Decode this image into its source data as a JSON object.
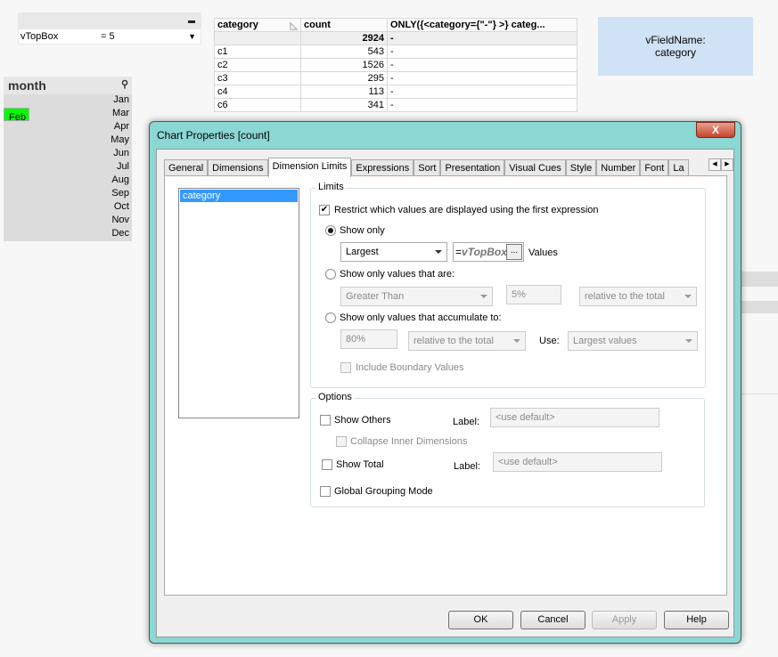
{
  "input_box": {
    "variable": "vTopBox",
    "value": "= 5"
  },
  "table": {
    "headers": [
      "category",
      "count",
      "ONLY({<category={\"-\"} >} categ..."
    ],
    "total": {
      "count": "2924",
      "only": "-"
    },
    "rows": [
      [
        "c1",
        "543",
        "-"
      ],
      [
        "c2",
        "1526",
        "-"
      ],
      [
        "c3",
        "295",
        "-"
      ],
      [
        "c4",
        "113",
        "-"
      ],
      [
        "c6",
        "341",
        "-"
      ]
    ]
  },
  "text_object": {
    "line1": "vFieldName:",
    "line2": "category"
  },
  "listbox": {
    "title": "month",
    "items": [
      "Jan",
      "Feb",
      "Mar",
      "Apr",
      "May",
      "Jun",
      "Jul",
      "Aug",
      "Sep",
      "Oct",
      "Nov",
      "Dec"
    ],
    "selected": "Feb"
  },
  "dialog": {
    "title": "Chart Properties [count]",
    "close": "X",
    "tabs": [
      "General",
      "Dimensions",
      "Dimension Limits",
      "Expressions",
      "Sort",
      "Presentation",
      "Visual Cues",
      "Style",
      "Number",
      "Font",
      "La"
    ],
    "active_tab": "Dimension Limits",
    "dimensions": [
      "category"
    ],
    "limits": {
      "legend": "Limits",
      "restrict_label": "Restrict which values are displayed using the first expression",
      "restrict_checked": true,
      "show_only_label": "Show only",
      "show_only_selected": true,
      "show_only_mode": "Largest",
      "show_only_expr": "=vTopBox",
      "expr_btn": "...",
      "values_label": "Values",
      "values_are_label": "Show only values that are:",
      "compare": "Greater Than",
      "compare_value": "5%",
      "relative1": "relative to the total",
      "accumulate_label": "Show only values that accumulate to:",
      "accum_value": "80%",
      "relative2": "relative to the total",
      "use_label": "Use:",
      "use_value": "Largest values",
      "boundary_label": "Include Boundary Values"
    },
    "options": {
      "legend": "Options",
      "show_others": "Show Others",
      "label1": "Label:",
      "placeholder1": "<use default>",
      "collapse": "Collapse Inner Dimensions",
      "show_total": "Show Total",
      "label2": "Label:",
      "placeholder2": "<use default>",
      "global": "Global Grouping Mode"
    },
    "buttons": {
      "ok": "OK",
      "cancel": "Cancel",
      "apply": "Apply",
      "help": "Help"
    }
  }
}
